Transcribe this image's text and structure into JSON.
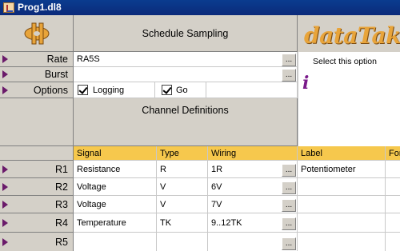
{
  "window": {
    "title": "Prog1.dl8"
  },
  "schedule": {
    "title": "Schedule Sampling"
  },
  "brand": {
    "text": "dataTaker"
  },
  "icons": {
    "logo": "datataker-logo-icon",
    "info": "info-icon",
    "row_arrow": "row-arrow-icon",
    "app": "app-icon"
  },
  "params": {
    "rate": {
      "label": "Rate",
      "value": "RA5S"
    },
    "burst": {
      "label": "Burst",
      "value": ""
    },
    "options": {
      "label": "Options",
      "logging": "Logging",
      "go": "Go",
      "logging_checked": true,
      "go_checked": true
    }
  },
  "info_panel": {
    "hint": "Select this option",
    "icon": "i"
  },
  "channels": {
    "title": "Channel Definitions",
    "headers": {
      "signal": "Signal",
      "type": "Type",
      "wiring": "Wiring",
      "label": "Label",
      "format": "Format"
    },
    "rows": [
      {
        "name": "R1",
        "signal": "Resistance",
        "type": "R",
        "wiring": "1R",
        "label": "Potentiometer"
      },
      {
        "name": "R2",
        "signal": "Voltage",
        "type": "V",
        "wiring": "6V",
        "label": ""
      },
      {
        "name": "R3",
        "signal": "Voltage",
        "type": "V",
        "wiring": "7V",
        "label": ""
      },
      {
        "name": "R4",
        "signal": "Temperature",
        "type": "TK",
        "wiring": "9..12TK",
        "label": ""
      },
      {
        "name": "R5",
        "signal": "",
        "type": "",
        "wiring": "",
        "label": ""
      }
    ]
  },
  "ellipsis_label": "...",
  "colors": {
    "header_gray": "#d4d0c8",
    "yellow": "#f6c84d",
    "arrow": "#6a1a6a",
    "brand": "#e8a43a",
    "titlebar": "#0a3c8f"
  }
}
